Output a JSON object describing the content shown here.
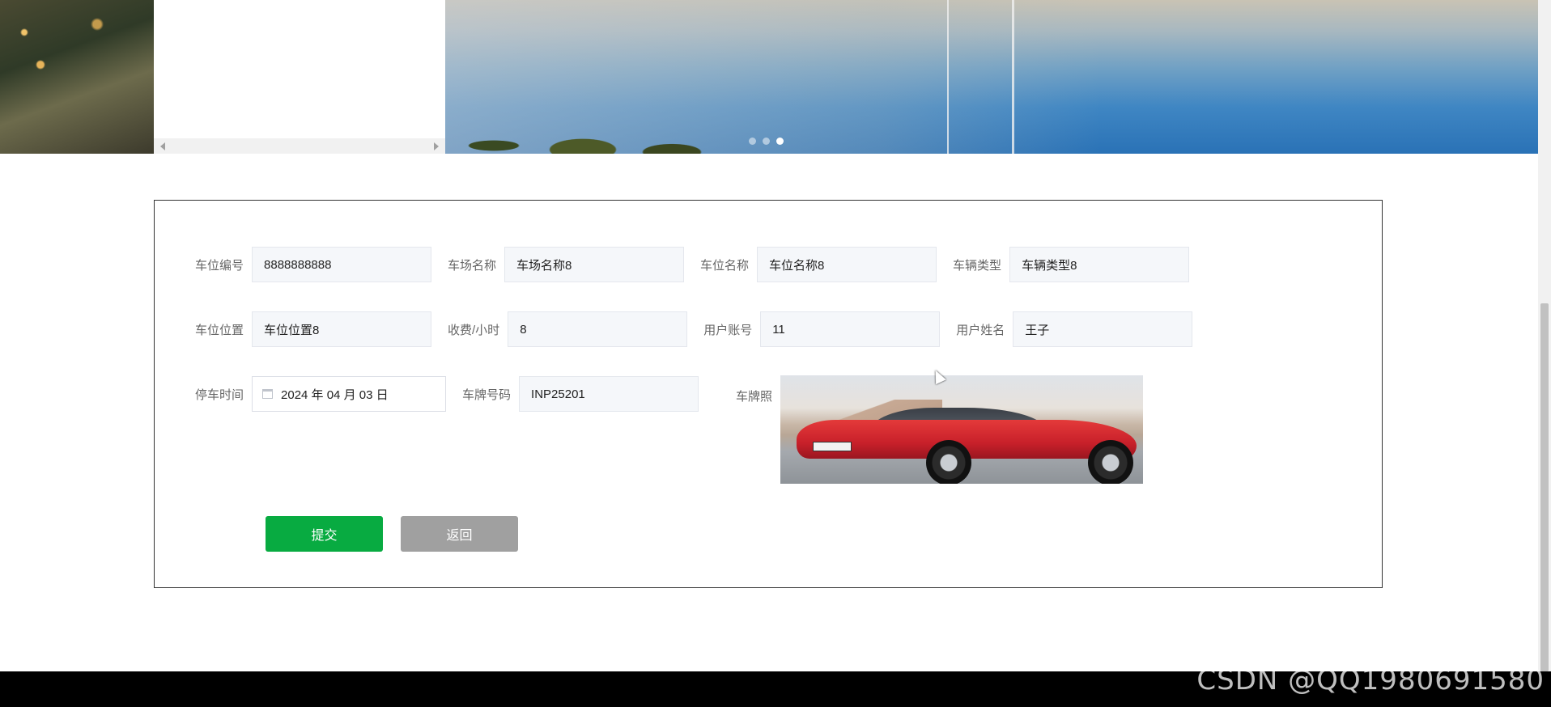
{
  "carousel": {
    "slides": 3,
    "active_slide": 3
  },
  "form": {
    "fields": [
      {
        "label": "车位编号",
        "value": "8888888888"
      },
      {
        "label": "车场名称",
        "value": "车场名称8"
      },
      {
        "label": "车位名称",
        "value": "车位名称8"
      },
      {
        "label": "车辆类型",
        "value": "车辆类型8"
      },
      {
        "label": "车位位置",
        "value": "车位位置8"
      },
      {
        "label": "收费/小时",
        "value": "8"
      },
      {
        "label": "用户账号",
        "value": "11"
      },
      {
        "label": "用户姓名",
        "value": "王子"
      }
    ],
    "parking_time": {
      "label": "停车时间",
      "value": "2024 年 04 月 03 日"
    },
    "plate_number": {
      "label": "车牌号码",
      "value": "INP25201"
    },
    "plate_photo": {
      "label": "车牌照"
    },
    "submit_label": "提交",
    "back_label": "返回"
  },
  "colors": {
    "submit": "#08ab41",
    "back": "#a0a0a0",
    "footer": "#000000"
  },
  "watermark": "CSDN @QQ1980691580"
}
